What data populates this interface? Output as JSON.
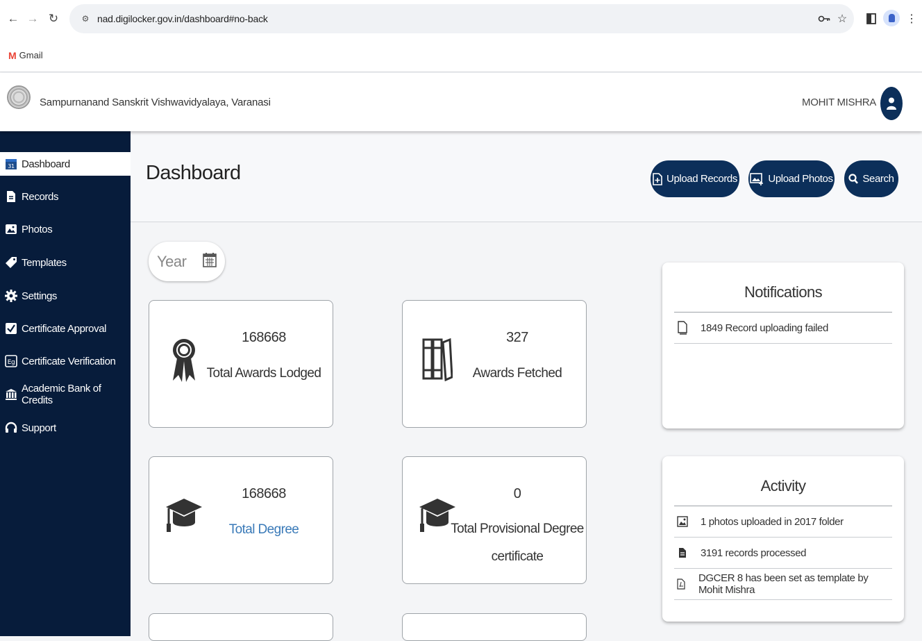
{
  "browser": {
    "url": "nad.digilocker.gov.in/dashboard#no-back",
    "bookmarks": [
      {
        "label": "Gmail",
        "icon": "gmail-icon"
      }
    ]
  },
  "header": {
    "institution": "Sampurnanand Sanskrit Vishwavidyalaya, Varanasi",
    "user": "MOHIT MISHRA"
  },
  "sidebar": {
    "items": [
      {
        "label": "Dashboard",
        "icon": "calendar-icon",
        "active": true
      },
      {
        "label": "Records",
        "icon": "document-icon"
      },
      {
        "label": "Photos",
        "icon": "photo-icon"
      },
      {
        "label": "Templates",
        "icon": "tag-icon"
      },
      {
        "label": "Settings",
        "icon": "gear-icon"
      },
      {
        "label": "Certificate Approval",
        "icon": "check-square-icon"
      },
      {
        "label": "Certificate Verification",
        "icon": "verification-icon"
      },
      {
        "label": "Academic Bank of Credits",
        "icon": "bank-icon"
      },
      {
        "label": "Support",
        "icon": "headphones-icon"
      }
    ]
  },
  "main": {
    "title": "Dashboard",
    "actions": {
      "upload_records": "Upload Records",
      "upload_photos": "Upload Photos",
      "search": "Search"
    },
    "year_placeholder": "Year",
    "stats": [
      {
        "value": "168668",
        "label": "Total Awards Lodged",
        "icon": "award-ribbon-icon"
      },
      {
        "value": "327",
        "label": "Awards Fetched",
        "icon": "books-icon"
      },
      {
        "value": "168668",
        "label": "Total Degree",
        "icon": "graduation-cap-icon"
      },
      {
        "value": "0",
        "label_line1": "Total Provisional Degree",
        "label_line2": "certificate",
        "icon": "graduation-cap-icon"
      }
    ]
  },
  "notifications": {
    "title": "Notifications",
    "items": [
      {
        "text": "1849 Record uploading failed",
        "icon": "file-outline-icon"
      }
    ]
  },
  "activity": {
    "title": "Activity",
    "items": [
      {
        "text": "1 photos uploaded in 2017 folder",
        "icon": "image-icon"
      },
      {
        "text": "3191 records processed",
        "icon": "file-text-icon"
      },
      {
        "text": "DGCER 8 has been set as template by Mohit Mishra",
        "icon": "pdf-file-icon"
      }
    ]
  },
  "colors": {
    "navy": "#0c2f5a",
    "sidebar": "#071c3b",
    "link": "#3a7ab8"
  }
}
